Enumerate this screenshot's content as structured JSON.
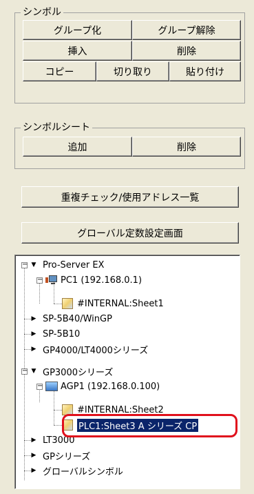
{
  "symbol_group": {
    "title": "シンボル",
    "group_button": "グループ化",
    "ungroup_button": "グループ解除",
    "insert_button": "挿入",
    "delete_button": "削除",
    "copy_button": "コピー",
    "cut_button": "切り取り",
    "paste_button": "貼り付け"
  },
  "symbol_sheet_group": {
    "title": "シンボルシート",
    "add_button": "追加",
    "delete_button": "削除"
  },
  "duplicate_check_button": "重複チェック/使用アドレス一覧",
  "global_constant_button": "グローバル定数設定画面",
  "tree": {
    "pro_server": "Pro-Server EX",
    "pc1": "PC1 (192.168.0.1)",
    "pc1_sheet": "#INTERNAL:Sheet1",
    "sp5b40": "SP-5B40/WinGP",
    "sp5b10": "SP-5B10",
    "gp4000": "GP4000/LT4000シリーズ",
    "gp3000": "GP3000シリーズ",
    "agp1": "AGP1 (192.168.0.100)",
    "agp1_sheet2": "#INTERNAL:Sheet2",
    "agp1_sheet3": "PLC1:Sheet3 A シリーズ CP",
    "lt3000": "LT3000",
    "gp_series": "GPシリーズ",
    "global_symbol": "グローバルシンボル"
  },
  "colors": {
    "panel_bg": "#ece9d8",
    "selection_bg": "#0a246a",
    "highlight_ring": "#e0101c"
  }
}
